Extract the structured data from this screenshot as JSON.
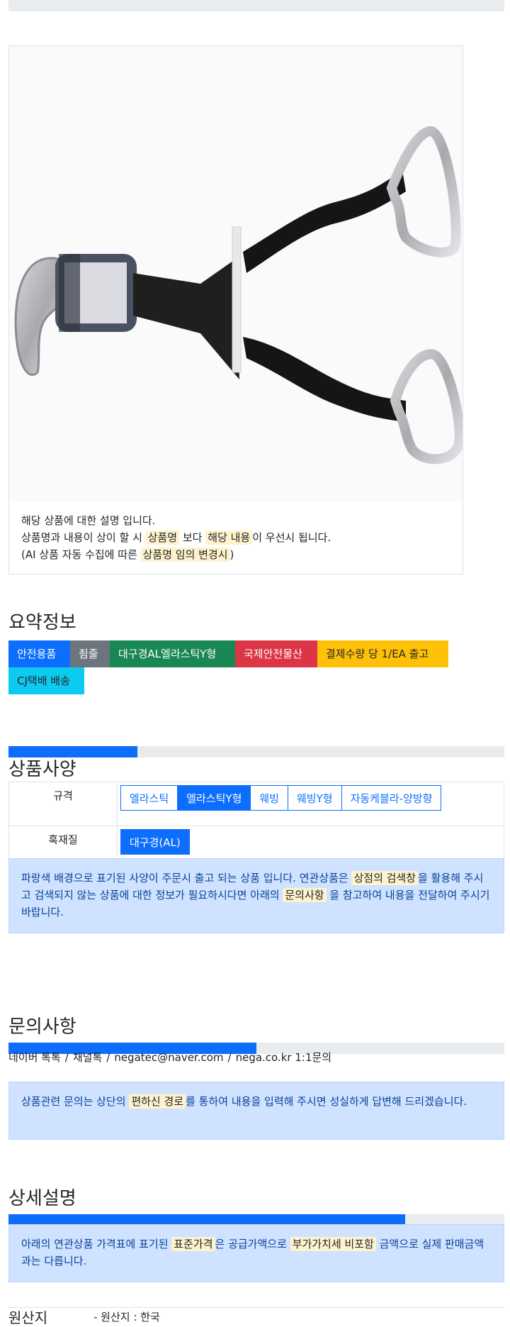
{
  "product": {
    "description_lines": {
      "line1": "해당 상품에 대한 설명 입니다.",
      "line2_a": "상품명과 내용이 상이 할 시",
      "line2_mark1": "상품명",
      "line2_b": "보다",
      "line2_mark2": "해당 내용",
      "line2_c": "이 우선시 됩니다.",
      "line3_a": "(AI 상품 자동 수집에 따른",
      "line3_mark": "상품명 임의 변경시",
      "line3_b": ")"
    }
  },
  "summary": {
    "title": "요약정보",
    "badges": [
      "안전용품",
      "죔줄",
      "대구경AL엘라스틱Y형",
      "국제안전물산",
      "결제수량 당 1/EA 출고",
      "CJ택배 배송"
    ]
  },
  "spec": {
    "progress": 0.26,
    "title": "상품사양",
    "rows": [
      {
        "label": "규격",
        "options": [
          "엘라스틱",
          "엘라스틱Y형",
          "웨빙",
          "웨빙Y형",
          "자동케블라-양방향"
        ],
        "selected": 1
      },
      {
        "label": "훅재질",
        "options": [
          "대구경(AL)"
        ],
        "selected": 0
      }
    ],
    "notice": {
      "a": "파랑색 배경으로 표기된 사양이 주문시 출고 되는 상품 입니다. 연관상품은",
      "mark1": "상점의 검색창",
      "b": "을 활용해 주시고 검색되지 않는 상품에 대한 정보가 필요하시다면 아래의",
      "mark2": "문의사항",
      "c": "을 참고하여 내용을 전달하여 주시기 바랍니다."
    }
  },
  "inquiry": {
    "title": "문의사항",
    "progress": 0.5,
    "contacts": [
      "네이버 톡톡",
      "채널톡",
      "negatec@naver.com",
      "nega.co.kr 1:1문의"
    ],
    "separator": "/",
    "notice": {
      "a": "상품관련 문의는 상단의",
      "mark": "편하신 경로",
      "b": "를 통하여 내용을 입력해 주시면 성실하게 답변해 드리겠습니다."
    }
  },
  "detail": {
    "title": "상세설명",
    "progress": 0.8,
    "notice": {
      "a": "아래의 연관상품 가격표에 표기된",
      "mark1": "표준가격",
      "b": "은 공급가액으로",
      "mark2": "부가가치세 비포함",
      "c": "금액으로 실제 판매금액과는 다릅니다."
    }
  },
  "origin": {
    "label": "원산지",
    "value": "- 원산지 : 한국"
  }
}
